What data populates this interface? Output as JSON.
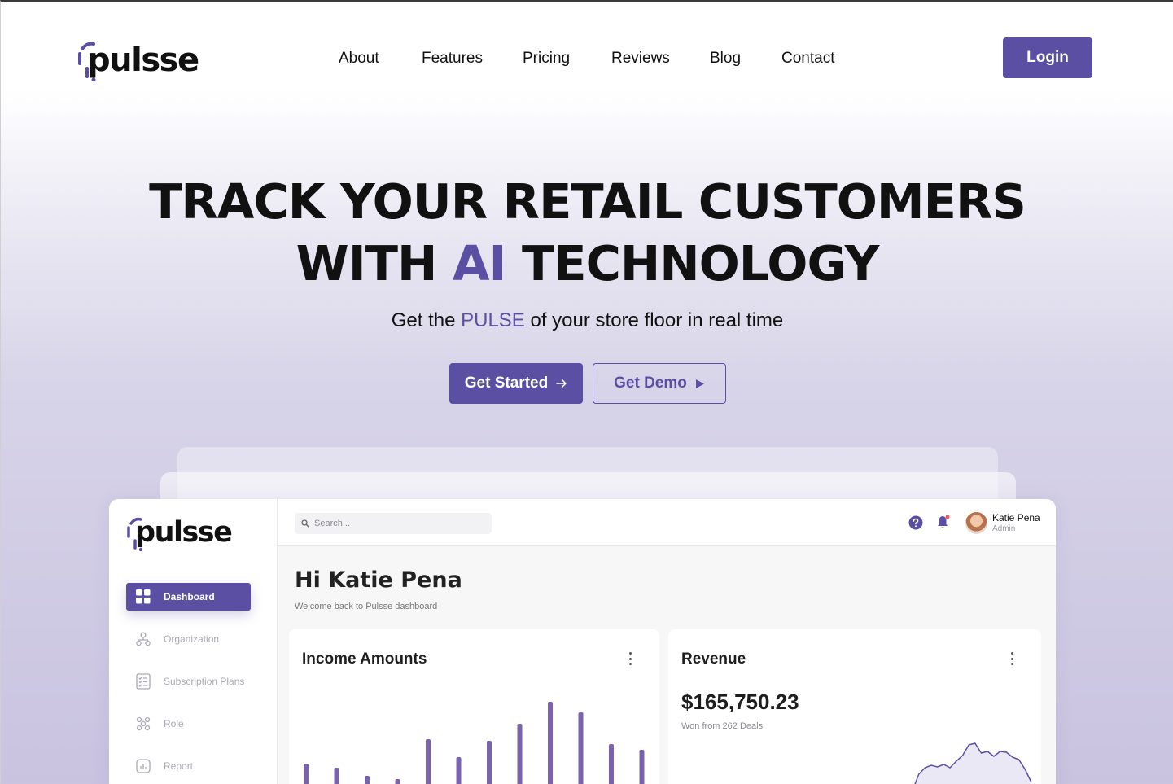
{
  "brand": {
    "logo_text": "ulsse",
    "logo_mark_letter": "p",
    "accent_color": "#5b4fa3"
  },
  "nav": {
    "items": [
      "About",
      "Features",
      "Pricing",
      "Reviews",
      "Blog",
      "Contact"
    ],
    "login_label": "Login"
  },
  "hero": {
    "title_line1": "TRACK YOUR RETAIL CUSTOMERS",
    "title_line2_before": "WITH ",
    "title_line2_accent": "AI",
    "title_line2_after": " TECHNOLOGY",
    "subtitle_before": "Get the ",
    "subtitle_accent": "PULSE",
    "subtitle_after": " of your store floor in real time",
    "cta_primary": "Get Started",
    "cta_secondary": "Get Demo"
  },
  "dashboard": {
    "sidebar": [
      {
        "label": "Dashboard",
        "icon": "grid-icon",
        "active": true
      },
      {
        "label": "Organization",
        "icon": "org-chart-icon",
        "active": false
      },
      {
        "label": "Subscription Plans",
        "icon": "checklist-icon",
        "active": false
      },
      {
        "label": "Role",
        "icon": "people-icon",
        "active": false
      },
      {
        "label": "Report",
        "icon": "chart-icon",
        "active": false
      }
    ],
    "search_placeholder": "Search...",
    "user": {
      "name": "Katie Pena",
      "role": "Admin"
    },
    "greeting": "Hi Katie Pena",
    "welcome": "Welcome back to Pulsse dashboard",
    "income_card": {
      "title": "Income Amounts"
    },
    "revenue_card": {
      "title": "Revenue",
      "value": "$165,750.23",
      "subtitle": "Won from 262 Deals"
    }
  },
  "chart_data": [
    {
      "type": "bar",
      "title": "Income Amounts",
      "values": [
        27,
        22,
        12,
        8,
        57,
        35,
        55,
        76,
        103,
        90,
        51,
        44
      ],
      "ylim": [
        0,
        110
      ],
      "color": "#7b63ab"
    },
    {
      "type": "area",
      "title": "Revenue",
      "values": [
        2,
        22,
        30,
        33,
        31,
        34,
        30,
        38,
        45,
        58,
        60,
        48,
        50,
        44,
        50,
        49,
        43,
        40,
        28,
        12
      ],
      "ylim": [
        0,
        65
      ],
      "color": "#5b4fa3"
    }
  ]
}
